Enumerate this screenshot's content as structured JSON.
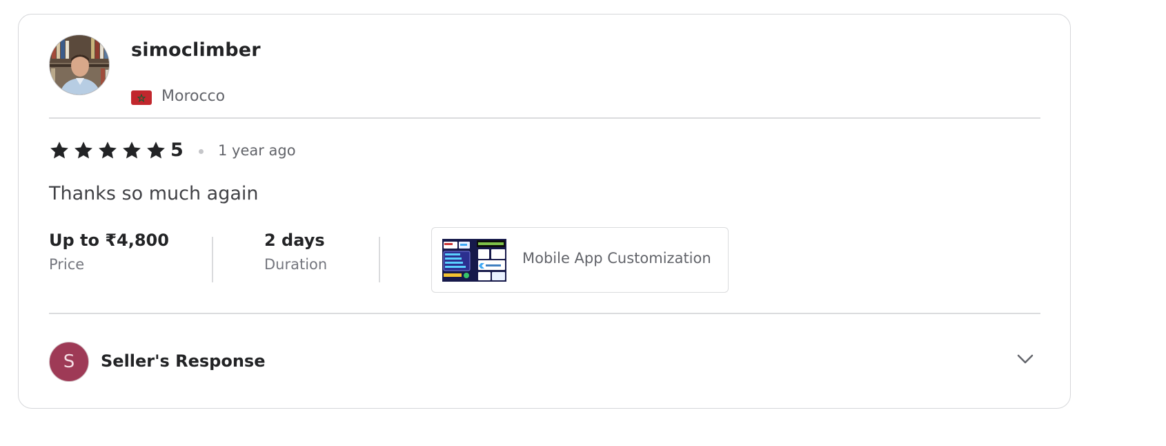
{
  "reviewer": {
    "username": "simoclimber",
    "country": "Morocco"
  },
  "review": {
    "rating": "5",
    "stars_filled": 5,
    "stars_total": 5,
    "time_ago": "1 year ago",
    "text": "Thanks so much again"
  },
  "meta": {
    "price_value": "Up to ₹4,800",
    "price_label": "Price",
    "duration_value": "2 days",
    "duration_label": "Duration"
  },
  "gig": {
    "title": "Mobile App Customization"
  },
  "seller_response": {
    "avatar_letter": "S",
    "label": "Seller's Response"
  },
  "colors": {
    "star": "#222325",
    "seller_avatar": "#9e3a56",
    "flag_red": "#c1272d",
    "flag_green": "#006233"
  },
  "icons": {
    "star": "star-icon",
    "flag": "morocco-flag-icon",
    "chevron": "chevron-down-icon"
  }
}
